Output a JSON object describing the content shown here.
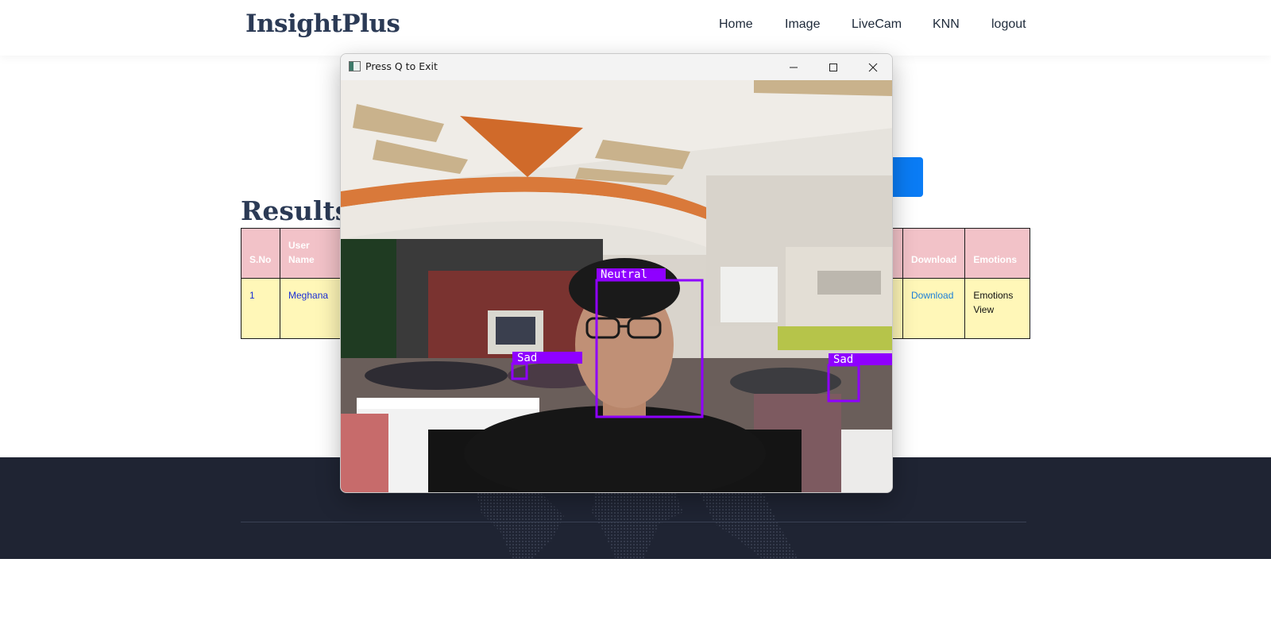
{
  "site": {
    "logo": "InsightPlus",
    "nav": [
      {
        "label": "Home"
      },
      {
        "label": "Image"
      },
      {
        "label": "LiveCam"
      },
      {
        "label": "KNN"
      },
      {
        "label": "logout"
      }
    ]
  },
  "main": {
    "heading": "Results t",
    "table": {
      "headers": {
        "sno": "S.No",
        "user_line1": "User",
        "user_line2": "Name",
        "download": "Download",
        "emotions": "Emotions"
      },
      "rows": [
        {
          "sno": "1",
          "user": "Meghana",
          "download": "Download",
          "emotions_line1": "Emotions",
          "emotions_line2": "View"
        }
      ]
    }
  },
  "cv_window": {
    "title": "Press Q to Exit",
    "detections": [
      {
        "label": "Neutral"
      },
      {
        "label": "Sad"
      },
      {
        "label": "Sad"
      }
    ],
    "box_color": "#8f00ff"
  },
  "colors": {
    "accent_blue": "#0a7cf5",
    "header_pink": "#f2c2c8",
    "row_yellow": "#fff7b8",
    "footer_dark": "#1f2433"
  }
}
